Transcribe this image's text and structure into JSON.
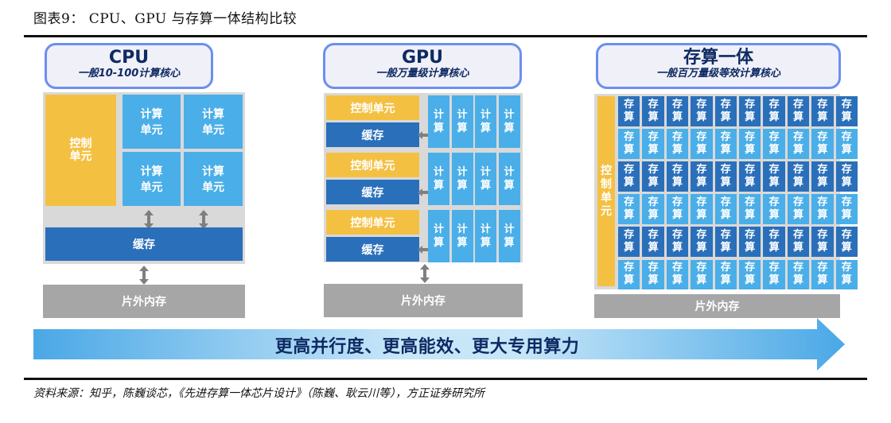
{
  "figure": {
    "title": "图表9：  CPU、GPU 与存算一体结构比较",
    "source": "资料来源：知乎，陈巍谈芯，《先进存算一体芯片设计》（陈巍、耿云川等），方正证券研究所"
  },
  "cpu": {
    "title": "CPU",
    "subtitle": "一般10-100计算核心",
    "control_unit": "控制单元",
    "compute_units": [
      "计算单元",
      "计算单元",
      "计算单元",
      "计算单元"
    ],
    "cache": "缓存",
    "offchip_memory": "片外内存"
  },
  "gpu": {
    "title": "GPU",
    "subtitle": "一般万量级计算核心",
    "groups": [
      {
        "control_unit": "控制单元",
        "cache": "缓存",
        "compute_units": [
          "计算",
          "计算",
          "计算",
          "计算"
        ]
      },
      {
        "control_unit": "控制单元",
        "cache": "缓存",
        "compute_units": [
          "计算",
          "计算",
          "计算",
          "计算"
        ]
      },
      {
        "control_unit": "控制单元",
        "cache": "缓存",
        "compute_units": [
          "计算",
          "计算",
          "计算",
          "计算"
        ]
      }
    ],
    "offchip_memory": "片外内存"
  },
  "cim": {
    "title": "存算一体",
    "subtitle": "一般百万量级等效计算核心",
    "control_unit": "控制单元",
    "cell_label": "存算",
    "rows": 6,
    "cols": 10,
    "offchip_memory": "片外内存"
  },
  "trend_arrow": {
    "label": "更高并行度、更高能效、更大专用算力"
  },
  "colors": {
    "control": "#f4c042",
    "compute_light": "#4aaee8",
    "cache_dark": "#2a6fba",
    "memory_grey": "#a6a6a6",
    "header_border": "#6b8ff0",
    "header_text": "#0e2a63"
  }
}
